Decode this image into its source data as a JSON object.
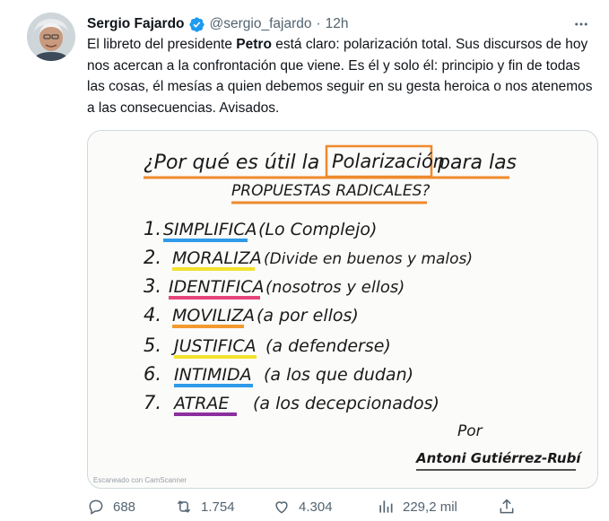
{
  "tweet": {
    "author_name": "Sergio Fajardo",
    "handle": "@sergio_fajardo",
    "separator": "·",
    "time": "12h",
    "text_part1": "El libreto del presidente ",
    "text_bold": "Petro",
    "text_part2": " está claro: polarización total. Sus discursos de hoy nos acercan a la confrontación que viene. Es él y solo él: principio y fin de todas las cosas, él mesías a quien debemos seguir en su gesta heroica o nos atenemos a las consecuencias. Avisados."
  },
  "image": {
    "title_line1_a": "¿Por qué es útil la",
    "title_boxed": "Polarización",
    "title_line1_b": "para las",
    "title_line2": "PROPUESTAS RADICALES?",
    "items": [
      {
        "num": "1.",
        "word": "SIMPLIFICA",
        "note": "(Lo Complejo)",
        "color": "#2f9be8"
      },
      {
        "num": "2.",
        "word": "MORALIZA",
        "note": "(Divide en buenos y malos)",
        "color": "#f2e22c"
      },
      {
        "num": "3.",
        "word": "IDENTIFICA",
        "note": "(nosotros y ellos)",
        "color": "#e8457c"
      },
      {
        "num": "4.",
        "word": "MOVILIZA",
        "note": "(a por ellos)",
        "color": "#f39a2f"
      },
      {
        "num": "5.",
        "word": "JUSTIFICA",
        "note": "(a defenderse)",
        "color": "#f2e22c"
      },
      {
        "num": "6.",
        "word": "INTIMIDA",
        "note": "(a los que dudan)",
        "color": "#2f9be8"
      },
      {
        "num": "7.",
        "word": "ATRAE",
        "note": "(a los decepcionados)",
        "color": "#8c2f9e"
      }
    ],
    "signature_by": "Por",
    "signature_name": "Antoni Gutiérrez-Rubí",
    "scanner_watermark": "Escaneado con CamScanner"
  },
  "actions": {
    "replies": "688",
    "retweets": "1.754",
    "likes": "4.304",
    "views": "229,2 mil"
  }
}
